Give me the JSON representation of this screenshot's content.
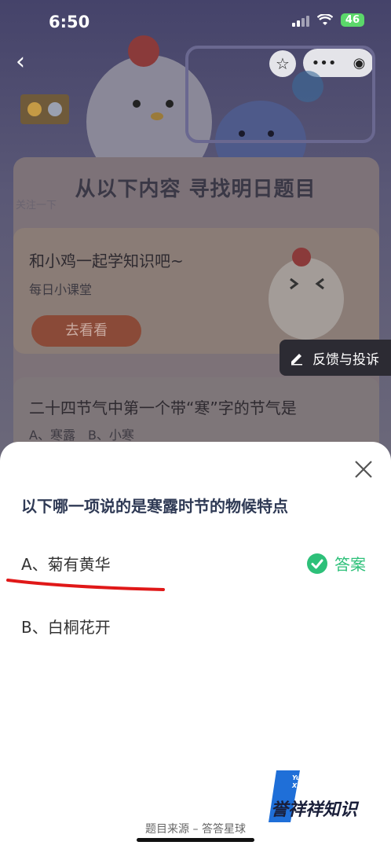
{
  "status_bar": {
    "time": "6:50",
    "battery": "46"
  },
  "background": {
    "title": "从以下内容 寻找明日题目",
    "subtitle": "关注一下",
    "lesson_title": "和小鸡一起学知识吧~",
    "lesson_sub": "每日小课堂",
    "lesson_button": "去看看",
    "quiz_question": "二十四节气中第一个带“寒”字的节气是",
    "quiz_options": "A、寒露　B、小寒",
    "feedback_label": "反馈与投诉"
  },
  "sheet": {
    "question": "以下哪一项说的是寒露时节的物候特点",
    "options": [
      "A、菊有黄华",
      "B、白桐花开"
    ],
    "answer_label": "答案",
    "source": "题目来源 – 答答星球"
  },
  "watermark": {
    "line1": "YuXiang",
    "line2": "XiangZhiShi",
    "main": "誉祥祥知识"
  },
  "colors": {
    "answer_green": "#2dc079",
    "underline_red": "#e01818"
  }
}
